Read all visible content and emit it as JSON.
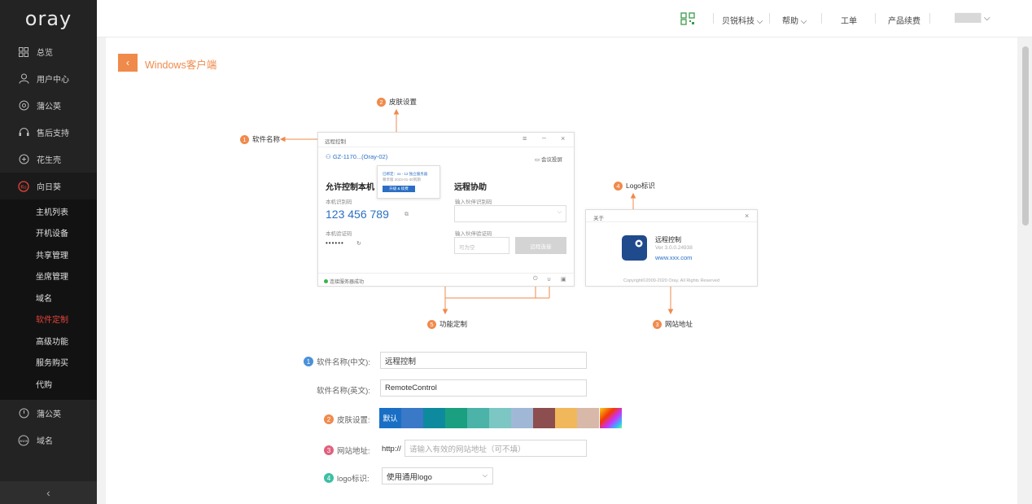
{
  "sidebar": {
    "logo": "oray",
    "items": [
      {
        "label": "总览",
        "icon": "grid-icon"
      },
      {
        "label": "用户中心",
        "icon": "user-icon"
      },
      {
        "label": "蒲公英",
        "icon": "target-icon"
      },
      {
        "label": "售后支持",
        "icon": "headset-icon"
      },
      {
        "label": "花生壳",
        "icon": "peanut-icon"
      },
      {
        "label": "向日葵",
        "icon": "sunflower-icon"
      }
    ],
    "sub_items": [
      "主机列表",
      "开机设备",
      "共享管理",
      "坐席管理",
      "域名",
      "软件定制",
      "高级功能",
      "服务购买",
      "代购"
    ],
    "bottom_items": [
      {
        "label": "蒲公英",
        "icon": "power-icon"
      },
      {
        "label": "域名",
        "icon": "www-icon"
      }
    ],
    "collapse": "‹"
  },
  "topbar": {
    "company": "贝锐科技",
    "help": "帮助",
    "ticket": "工单",
    "renew": "产品续费",
    "user": "██████"
  },
  "page": {
    "back": "‹",
    "title": "Windows客户端"
  },
  "callouts": {
    "c1": {
      "num": "1",
      "text": "软件名称"
    },
    "c2": {
      "num": "2",
      "text": "皮肤设置"
    },
    "c3": {
      "num": "3",
      "text": "网站地址"
    },
    "c4": {
      "num": "4",
      "text": "Logo标识"
    },
    "c5": {
      "num": "5",
      "text": "功能定制"
    }
  },
  "mock_window": {
    "title": "远程控制",
    "account": "GZ-1170...(Oray-02)",
    "screen_btn": "会议投屏",
    "allow_title": "允许控制本机",
    "id_label": "本机识别码",
    "id_value": "123 456 789",
    "code_label": "本机验证码",
    "code_value": "••••••",
    "remote_title": "远程协助",
    "partner_id_label": "输入伙伴识别码",
    "partner_code_label": "输入伙伴验证码",
    "partner_code_ph": "可为空",
    "connect": "远程连接",
    "status": "连接服务器成功",
    "popup_line1": "已绑定：xx - 12 独立服务器",
    "popup_line2": "尊享版 2023-01-30到期",
    "popup_btn": "升级 & 续费"
  },
  "about_window": {
    "title": "关于",
    "app_name": "远程控制",
    "version": "Ver 3.0.0.24938",
    "url": "www.xxx.com",
    "copyright": "Copyright©2009-2020 Oray. All Rights Reserved"
  },
  "form": {
    "name_cn_label": "软件名称(中文):",
    "name_cn_value": "远程控制",
    "name_en_label": "软件名称(英文):",
    "name_en_value": "RemoteControl",
    "skin_label": "皮肤设置:",
    "skin_default": "默认",
    "skins": [
      "#1a6fc4",
      "#3a78c8",
      "#0e8a9e",
      "#1aa080",
      "#4bb3a8",
      "#7cc7c4",
      "#a0b8d6",
      "#8c4e4e",
      "#f0b85a",
      "#d8b8a8"
    ],
    "url_label": "网站地址:",
    "url_prefix": "http://",
    "url_placeholder": "请输入有效的网站地址（可不填）",
    "logo_label": "logo标识:",
    "logo_value": "使用通用logo",
    "num_colors": {
      "n1": "#4a90d9",
      "n2": "#f08a4b",
      "n3": "#e0607e",
      "n4": "#3dbfa3"
    }
  },
  "colors": {
    "accent": "#f08a4b",
    "sidebar_bg": "#232323",
    "active_red": "#e2453a"
  }
}
